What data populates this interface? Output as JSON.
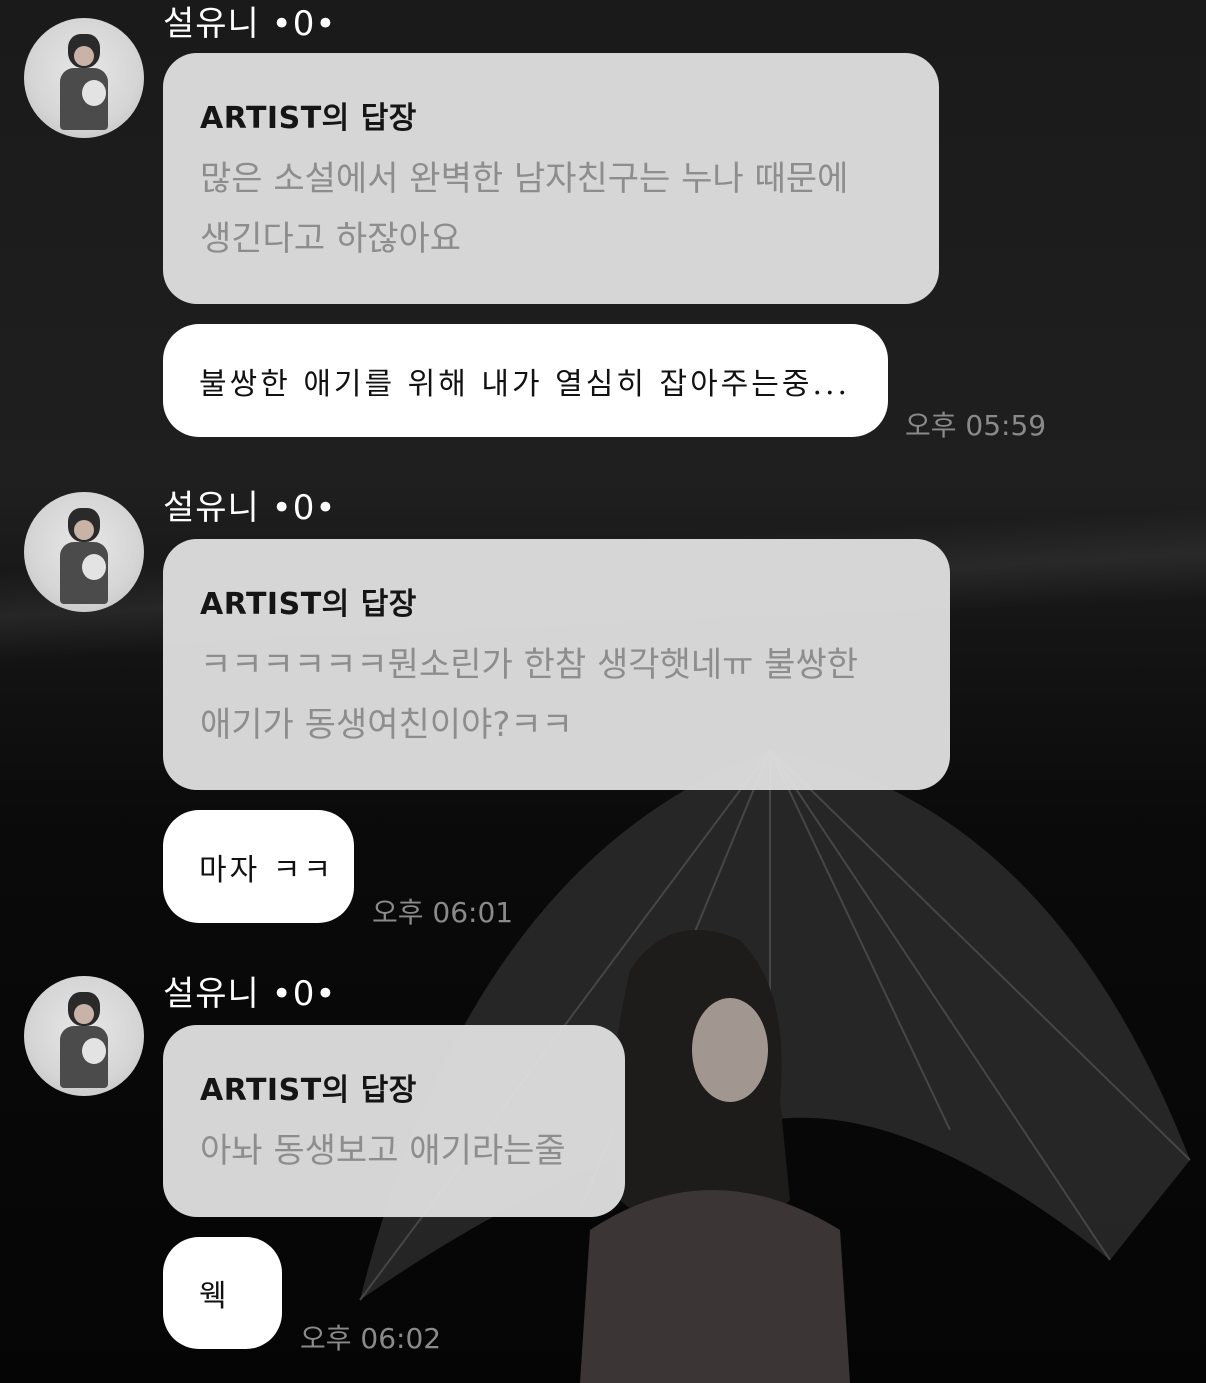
{
  "messages": [
    {
      "sender": "설유니 •0•",
      "reply_title": "ARTIST의 답장",
      "reply_lines": [
        "많은 소설에서 완벽한 남자친구는 누나 때문에",
        "생긴다고 하잖아요"
      ],
      "message": "불쌍한 애기를 위해 내가 열심히 잡아주는중...",
      "time": "오후 05:59"
    },
    {
      "sender": "설유니 •0•",
      "reply_title": "ARTIST의 답장",
      "reply_lines": [
        "ㅋㅋㅋㅋㅋㅋ뭔소린가 한참 생각햇네ㅠ 불쌍한",
        "애기가 동생여친이야?ㅋㅋ"
      ],
      "message": "마자 ㅋㅋ",
      "time": "오후 06:01"
    },
    {
      "sender": "설유니 •0•",
      "reply_title": "ARTIST의 답장",
      "reply_lines": [
        "아놔 동생보고 애기라는줄"
      ],
      "message": "웩",
      "time": "오후 06:02"
    }
  ]
}
